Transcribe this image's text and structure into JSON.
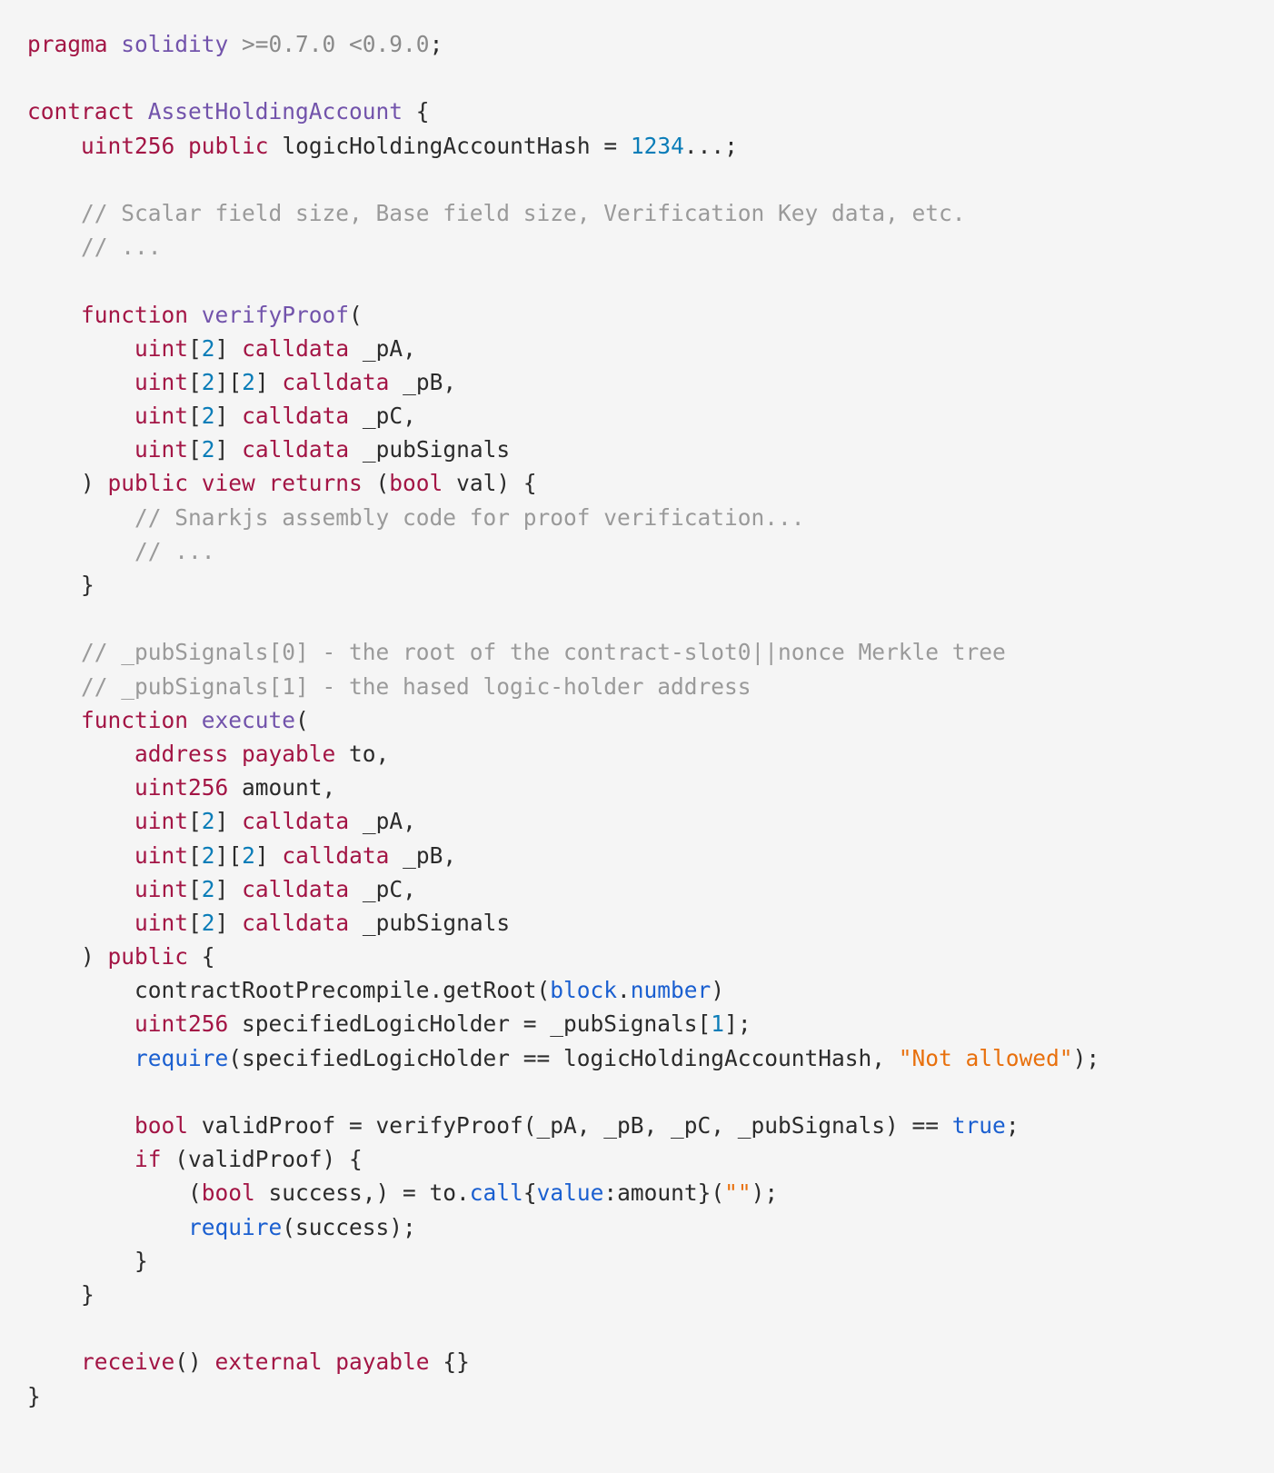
{
  "editor": {
    "language": "solidity",
    "background_color": "#f5f5f5",
    "colors": {
      "keyword": "#a31545",
      "type": "#7253ab",
      "number": "#0b7db8",
      "builtin": "#1a5fd0",
      "string": "#e8700d",
      "comment": "#9a9a9a",
      "plain": "#2b2b2b"
    }
  },
  "code": {
    "full_text": "pragma solidity >=0.7.0 <0.9.0;\n\ncontract AssetHoldingAccount {\n    uint256 public logicHoldingAccountHash = 1234...;\n\n    // Scalar field size, Base field size, Verification Key data, etc.\n    // ...\n\n    function verifyProof(\n        uint[2] calldata _pA,\n        uint[2][2] calldata _pB,\n        uint[2] calldata _pC,\n        uint[2] calldata _pubSignals\n    ) public view returns (bool val) {\n        // Snarkjs assembly code for proof verification...\n        // ...\n    }\n\n    // _pubSignals[0] - the root of the contract-slot0||nonce Merkle tree\n    // _pubSignals[1] - the hased logic-holder address\n    function execute(\n        address payable to,\n        uint256 amount,\n        uint[2] calldata _pA,\n        uint[2][2] calldata _pB,\n        uint[2] calldata _pC,\n        uint[2] calldata _pubSignals\n    ) public {\n        contractRootPrecompile.getRoot(block.number)\n        uint256 specifiedLogicHolder = _pubSignals[1];\n        require(specifiedLogicHolder == logicHoldingAccountHash, \"Not allowed\");\n\n        bool validProof = verifyProof(_pA, _pB, _pC, _pubSignals) == true;\n        if (validProof) {\n            (bool success,) = to.call{value:amount}(\"\");\n            require(success);\n        }\n    }\n\n    receive() external payable {}\n}",
    "lines": [
      {
        "n": 1,
        "tokens": [
          {
            "t": "pragma ",
            "c": "kw"
          },
          {
            "t": "solidity",
            "c": "type"
          },
          {
            "t": " ",
            "c": "plain"
          },
          {
            "t": ">=0.7.0 <0.9.0",
            "c": "dim"
          },
          {
            "t": ";",
            "c": "plain"
          }
        ]
      },
      {
        "n": 2,
        "tokens": []
      },
      {
        "n": 3,
        "tokens": [
          {
            "t": "contract ",
            "c": "kw"
          },
          {
            "t": "AssetHoldingAccount",
            "c": "type"
          },
          {
            "t": " {",
            "c": "plain"
          }
        ]
      },
      {
        "n": 4,
        "tokens": [
          {
            "t": "    ",
            "c": "plain"
          },
          {
            "t": "uint256",
            "c": "kw"
          },
          {
            "t": " ",
            "c": "plain"
          },
          {
            "t": "public",
            "c": "kw"
          },
          {
            "t": " logicHoldingAccountHash = ",
            "c": "plain"
          },
          {
            "t": "1234",
            "c": "num"
          },
          {
            "t": "...;",
            "c": "plain"
          }
        ]
      },
      {
        "n": 5,
        "tokens": []
      },
      {
        "n": 6,
        "tokens": [
          {
            "t": "    ",
            "c": "plain"
          },
          {
            "t": "// Scalar field size, Base field size, Verification Key data, etc.",
            "c": "cmt"
          }
        ]
      },
      {
        "n": 7,
        "tokens": [
          {
            "t": "    ",
            "c": "plain"
          },
          {
            "t": "// ...",
            "c": "cmt"
          }
        ]
      },
      {
        "n": 8,
        "tokens": []
      },
      {
        "n": 9,
        "tokens": [
          {
            "t": "    ",
            "c": "plain"
          },
          {
            "t": "function ",
            "c": "kw"
          },
          {
            "t": "verifyProof",
            "c": "type"
          },
          {
            "t": "(",
            "c": "plain"
          }
        ]
      },
      {
        "n": 10,
        "tokens": [
          {
            "t": "        ",
            "c": "plain"
          },
          {
            "t": "uint",
            "c": "kw"
          },
          {
            "t": "[",
            "c": "plain"
          },
          {
            "t": "2",
            "c": "num"
          },
          {
            "t": "] ",
            "c": "plain"
          },
          {
            "t": "calldata",
            "c": "kw"
          },
          {
            "t": " _pA,",
            "c": "plain"
          }
        ]
      },
      {
        "n": 11,
        "tokens": [
          {
            "t": "        ",
            "c": "plain"
          },
          {
            "t": "uint",
            "c": "kw"
          },
          {
            "t": "[",
            "c": "plain"
          },
          {
            "t": "2",
            "c": "num"
          },
          {
            "t": "][",
            "c": "plain"
          },
          {
            "t": "2",
            "c": "num"
          },
          {
            "t": "] ",
            "c": "plain"
          },
          {
            "t": "calldata",
            "c": "kw"
          },
          {
            "t": " _pB,",
            "c": "plain"
          }
        ]
      },
      {
        "n": 12,
        "tokens": [
          {
            "t": "        ",
            "c": "plain"
          },
          {
            "t": "uint",
            "c": "kw"
          },
          {
            "t": "[",
            "c": "plain"
          },
          {
            "t": "2",
            "c": "num"
          },
          {
            "t": "] ",
            "c": "plain"
          },
          {
            "t": "calldata",
            "c": "kw"
          },
          {
            "t": " _pC,",
            "c": "plain"
          }
        ]
      },
      {
        "n": 13,
        "tokens": [
          {
            "t": "        ",
            "c": "plain"
          },
          {
            "t": "uint",
            "c": "kw"
          },
          {
            "t": "[",
            "c": "plain"
          },
          {
            "t": "2",
            "c": "num"
          },
          {
            "t": "] ",
            "c": "plain"
          },
          {
            "t": "calldata",
            "c": "kw"
          },
          {
            "t": " _pubSignals",
            "c": "plain"
          }
        ]
      },
      {
        "n": 14,
        "tokens": [
          {
            "t": "    ) ",
            "c": "plain"
          },
          {
            "t": "public view returns",
            "c": "kw"
          },
          {
            "t": " (",
            "c": "plain"
          },
          {
            "t": "bool",
            "c": "kw"
          },
          {
            "t": " val) {",
            "c": "plain"
          }
        ]
      },
      {
        "n": 15,
        "tokens": [
          {
            "t": "        ",
            "c": "plain"
          },
          {
            "t": "// Snarkjs assembly code for proof verification...",
            "c": "cmt"
          }
        ]
      },
      {
        "n": 16,
        "tokens": [
          {
            "t": "        ",
            "c": "plain"
          },
          {
            "t": "// ...",
            "c": "cmt"
          }
        ]
      },
      {
        "n": 17,
        "tokens": [
          {
            "t": "    }",
            "c": "plain"
          }
        ]
      },
      {
        "n": 18,
        "tokens": []
      },
      {
        "n": 19,
        "tokens": [
          {
            "t": "    ",
            "c": "plain"
          },
          {
            "t": "// _pubSignals[0] - the root of the contract-slot0||nonce Merkle tree",
            "c": "cmt"
          }
        ]
      },
      {
        "n": 20,
        "tokens": [
          {
            "t": "    ",
            "c": "plain"
          },
          {
            "t": "// _pubSignals[1] - the hased logic-holder address",
            "c": "cmt"
          }
        ]
      },
      {
        "n": 21,
        "tokens": [
          {
            "t": "    ",
            "c": "plain"
          },
          {
            "t": "function ",
            "c": "kw"
          },
          {
            "t": "execute",
            "c": "type"
          },
          {
            "t": "(",
            "c": "plain"
          }
        ]
      },
      {
        "n": 22,
        "tokens": [
          {
            "t": "        ",
            "c": "plain"
          },
          {
            "t": "address payable",
            "c": "kw"
          },
          {
            "t": " to,",
            "c": "plain"
          }
        ]
      },
      {
        "n": 23,
        "tokens": [
          {
            "t": "        ",
            "c": "plain"
          },
          {
            "t": "uint256",
            "c": "kw"
          },
          {
            "t": " amount,",
            "c": "plain"
          }
        ]
      },
      {
        "n": 24,
        "tokens": [
          {
            "t": "        ",
            "c": "plain"
          },
          {
            "t": "uint",
            "c": "kw"
          },
          {
            "t": "[",
            "c": "plain"
          },
          {
            "t": "2",
            "c": "num"
          },
          {
            "t": "] ",
            "c": "plain"
          },
          {
            "t": "calldata",
            "c": "kw"
          },
          {
            "t": " _pA,",
            "c": "plain"
          }
        ]
      },
      {
        "n": 25,
        "tokens": [
          {
            "t": "        ",
            "c": "plain"
          },
          {
            "t": "uint",
            "c": "kw"
          },
          {
            "t": "[",
            "c": "plain"
          },
          {
            "t": "2",
            "c": "num"
          },
          {
            "t": "][",
            "c": "plain"
          },
          {
            "t": "2",
            "c": "num"
          },
          {
            "t": "] ",
            "c": "plain"
          },
          {
            "t": "calldata",
            "c": "kw"
          },
          {
            "t": " _pB,",
            "c": "plain"
          }
        ]
      },
      {
        "n": 26,
        "tokens": [
          {
            "t": "        ",
            "c": "plain"
          },
          {
            "t": "uint",
            "c": "kw"
          },
          {
            "t": "[",
            "c": "plain"
          },
          {
            "t": "2",
            "c": "num"
          },
          {
            "t": "] ",
            "c": "plain"
          },
          {
            "t": "calldata",
            "c": "kw"
          },
          {
            "t": " _pC,",
            "c": "plain"
          }
        ]
      },
      {
        "n": 27,
        "tokens": [
          {
            "t": "        ",
            "c": "plain"
          },
          {
            "t": "uint",
            "c": "kw"
          },
          {
            "t": "[",
            "c": "plain"
          },
          {
            "t": "2",
            "c": "num"
          },
          {
            "t": "] ",
            "c": "plain"
          },
          {
            "t": "calldata",
            "c": "kw"
          },
          {
            "t": " _pubSignals",
            "c": "plain"
          }
        ]
      },
      {
        "n": 28,
        "tokens": [
          {
            "t": "    ) ",
            "c": "plain"
          },
          {
            "t": "public",
            "c": "kw"
          },
          {
            "t": " {",
            "c": "plain"
          }
        ]
      },
      {
        "n": 29,
        "tokens": [
          {
            "t": "        contractRootPrecompile.getRoot(",
            "c": "plain"
          },
          {
            "t": "block",
            "c": "builtin"
          },
          {
            "t": ".",
            "c": "plain"
          },
          {
            "t": "number",
            "c": "builtin"
          },
          {
            "t": ")",
            "c": "plain"
          }
        ]
      },
      {
        "n": 30,
        "tokens": [
          {
            "t": "        ",
            "c": "plain"
          },
          {
            "t": "uint256",
            "c": "kw"
          },
          {
            "t": " specifiedLogicHolder = _pubSignals[",
            "c": "plain"
          },
          {
            "t": "1",
            "c": "num"
          },
          {
            "t": "];",
            "c": "plain"
          }
        ]
      },
      {
        "n": 31,
        "tokens": [
          {
            "t": "        ",
            "c": "plain"
          },
          {
            "t": "require",
            "c": "builtin"
          },
          {
            "t": "(specifiedLogicHolder == logicHoldingAccountHash, ",
            "c": "plain"
          },
          {
            "t": "\"Not allowed\"",
            "c": "str"
          },
          {
            "t": ");",
            "c": "plain"
          }
        ]
      },
      {
        "n": 32,
        "tokens": []
      },
      {
        "n": 33,
        "tokens": [
          {
            "t": "        ",
            "c": "plain"
          },
          {
            "t": "bool",
            "c": "kw"
          },
          {
            "t": " validProof = verifyProof(_pA, _pB, _pC, _pubSignals) == ",
            "c": "plain"
          },
          {
            "t": "true",
            "c": "builtin"
          },
          {
            "t": ";",
            "c": "plain"
          }
        ]
      },
      {
        "n": 34,
        "tokens": [
          {
            "t": "        ",
            "c": "plain"
          },
          {
            "t": "if",
            "c": "kw"
          },
          {
            "t": " (validProof) {",
            "c": "plain"
          }
        ]
      },
      {
        "n": 35,
        "tokens": [
          {
            "t": "            (",
            "c": "plain"
          },
          {
            "t": "bool",
            "c": "kw"
          },
          {
            "t": " success,) = to.",
            "c": "plain"
          },
          {
            "t": "call",
            "c": "builtin"
          },
          {
            "t": "{",
            "c": "plain"
          },
          {
            "t": "value",
            "c": "builtin"
          },
          {
            "t": ":amount}(",
            "c": "plain"
          },
          {
            "t": "\"\"",
            "c": "str"
          },
          {
            "t": ");",
            "c": "plain"
          }
        ]
      },
      {
        "n": 36,
        "tokens": [
          {
            "t": "            ",
            "c": "plain"
          },
          {
            "t": "require",
            "c": "builtin"
          },
          {
            "t": "(success);",
            "c": "plain"
          }
        ]
      },
      {
        "n": 37,
        "tokens": [
          {
            "t": "        }",
            "c": "plain"
          }
        ]
      },
      {
        "n": 38,
        "tokens": [
          {
            "t": "    }",
            "c": "plain"
          }
        ]
      },
      {
        "n": 39,
        "tokens": []
      },
      {
        "n": 40,
        "tokens": [
          {
            "t": "    ",
            "c": "plain"
          },
          {
            "t": "receive",
            "c": "kw"
          },
          {
            "t": "() ",
            "c": "plain"
          },
          {
            "t": "external payable",
            "c": "kw"
          },
          {
            "t": " {}",
            "c": "plain"
          }
        ]
      },
      {
        "n": 41,
        "tokens": [
          {
            "t": "}",
            "c": "plain"
          }
        ]
      }
    ]
  }
}
